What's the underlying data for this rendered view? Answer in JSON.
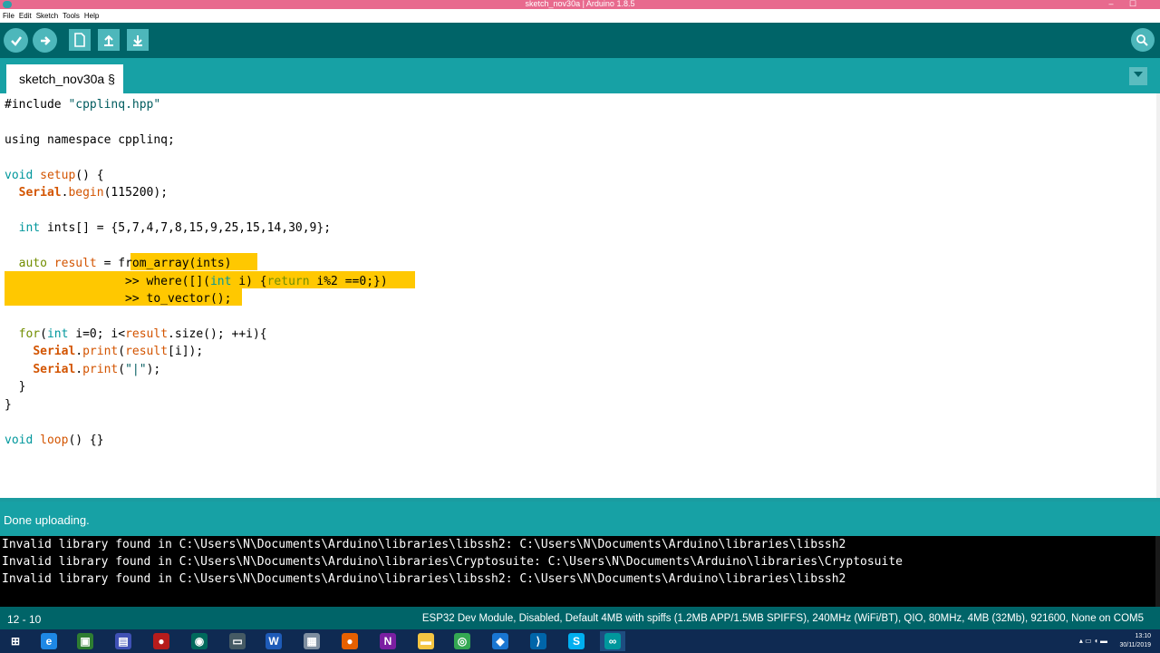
{
  "window": {
    "title": "sketch_nov30a | Arduino 1.8.5",
    "controls": [
      "–",
      "☐"
    ]
  },
  "menu": [
    "File",
    "Edit",
    "Sketch",
    "Tools",
    "Help"
  ],
  "toolbar": {
    "verify_icon": "check-icon",
    "upload_icon": "arrow-right-icon",
    "new_icon": "new-file-icon",
    "open_icon": "arrow-up-icon",
    "save_icon": "arrow-down-icon",
    "serial_monitor_icon": "magnifier-icon"
  },
  "tab": {
    "label": "sketch_nov30a §"
  },
  "editor": {
    "lines": [
      {
        "segments": [
          {
            "t": "#include ",
            "c": ""
          },
          {
            "t": "\"cpplinq.hpp\"",
            "c": "str"
          }
        ]
      },
      {
        "segments": []
      },
      {
        "segments": [
          {
            "t": "using namespace cpplinq;",
            "c": ""
          }
        ]
      },
      {
        "segments": []
      },
      {
        "segments": [
          {
            "t": "void",
            "c": "kw"
          },
          {
            "t": " ",
            "c": ""
          },
          {
            "t": "setup",
            "c": "fn"
          },
          {
            "t": "() {",
            "c": ""
          }
        ]
      },
      {
        "segments": [
          {
            "t": "  ",
            "c": ""
          },
          {
            "t": "Serial",
            "c": "cls"
          },
          {
            "t": ".",
            "c": ""
          },
          {
            "t": "begin",
            "c": "fn"
          },
          {
            "t": "(115200);",
            "c": ""
          }
        ]
      },
      {
        "segments": []
      },
      {
        "segments": [
          {
            "t": "  ",
            "c": ""
          },
          {
            "t": "int",
            "c": "kw"
          },
          {
            "t": " ints[] = {5,7,4,7,8,15,9,25,15,14,30,9};",
            "c": ""
          }
        ]
      },
      {
        "segments": []
      },
      {
        "segments": [
          {
            "t": "  ",
            "c": ""
          },
          {
            "t": "auto",
            "c": "kw2"
          },
          {
            "t": " ",
            "c": ""
          },
          {
            "t": "result",
            "c": "fn"
          },
          {
            "t": " = ",
            "c": ""
          },
          {
            "t": "from_array(ints)",
            "c": ""
          }
        ]
      },
      {
        "segments": [
          {
            "t": "                 >> where([](",
            "c": ""
          },
          {
            "t": "int",
            "c": "kw"
          },
          {
            "t": " i) {",
            "c": ""
          },
          {
            "t": "return",
            "c": "kw2"
          },
          {
            "t": " i%2 ==0;})",
            "c": ""
          }
        ]
      },
      {
        "segments": [
          {
            "t": "                 >> to_vector();",
            "c": ""
          }
        ]
      },
      {
        "segments": []
      },
      {
        "segments": [
          {
            "t": "  ",
            "c": ""
          },
          {
            "t": "for",
            "c": "kw2"
          },
          {
            "t": "(",
            "c": ""
          },
          {
            "t": "int",
            "c": "kw"
          },
          {
            "t": " i=0; i<",
            "c": ""
          },
          {
            "t": "result",
            "c": "fn"
          },
          {
            "t": ".size(); ++i){",
            "c": ""
          }
        ]
      },
      {
        "segments": [
          {
            "t": "    ",
            "c": ""
          },
          {
            "t": "Serial",
            "c": "cls"
          },
          {
            "t": ".",
            "c": ""
          },
          {
            "t": "print",
            "c": "fn"
          },
          {
            "t": "(",
            "c": ""
          },
          {
            "t": "result",
            "c": "fn"
          },
          {
            "t": "[i]);",
            "c": ""
          }
        ]
      },
      {
        "segments": [
          {
            "t": "    ",
            "c": ""
          },
          {
            "t": "Serial",
            "c": "cls"
          },
          {
            "t": ".",
            "c": ""
          },
          {
            "t": "print",
            "c": "fn"
          },
          {
            "t": "(",
            "c": ""
          },
          {
            "t": "\"|\"",
            "c": "str"
          },
          {
            "t": ");",
            "c": ""
          }
        ]
      },
      {
        "segments": [
          {
            "t": "  }",
            "c": ""
          }
        ]
      },
      {
        "segments": [
          {
            "t": "}",
            "c": ""
          }
        ]
      },
      {
        "segments": []
      },
      {
        "segments": [
          {
            "t": "void",
            "c": "kw"
          },
          {
            "t": " ",
            "c": ""
          },
          {
            "t": "loop",
            "c": "fn"
          },
          {
            "t": "() {}",
            "c": ""
          }
        ]
      }
    ],
    "selection_color": "#ffc800"
  },
  "status": {
    "message": "Done uploading."
  },
  "console": {
    "lines": [
      "Invalid library found in C:\\Users\\N\\Documents\\Arduino\\libraries\\libssh2: C:\\Users\\N\\Documents\\Arduino\\libraries\\libssh2",
      "Invalid library found in C:\\Users\\N\\Documents\\Arduino\\libraries\\Cryptosuite: C:\\Users\\N\\Documents\\Arduino\\libraries\\Cryptosuite",
      "Invalid library found in C:\\Users\\N\\Documents\\Arduino\\libraries\\libssh2: C:\\Users\\N\\Documents\\Arduino\\libraries\\libssh2"
    ]
  },
  "footer": {
    "cursor": "12 - 10",
    "board": "ESP32 Dev Module, Disabled, Default 4MB with spiffs (1.2MB APP/1.5MB SPIFFS), 240MHz (WiFi/BT), QIO, 80MHz, 4MB (32Mb), 921600, None on COM5"
  },
  "taskbar": {
    "apps": [
      {
        "name": "windows-start-icon",
        "glyph": "⊞",
        "color": "#0f2a52"
      },
      {
        "name": "ie-icon",
        "glyph": "e",
        "color": "#1e88e5"
      },
      {
        "name": "app-green-icon",
        "glyph": "▣",
        "color": "#2e7d32"
      },
      {
        "name": "monitor-app-icon",
        "glyph": "▤",
        "color": "#3f51b5"
      },
      {
        "name": "pdf-reader-icon",
        "glyph": "●",
        "color": "#b71c1c"
      },
      {
        "name": "settings-app-icon",
        "glyph": "◉",
        "color": "#00695c"
      },
      {
        "name": "remote-desktop-icon",
        "glyph": "▭",
        "color": "#455a64"
      },
      {
        "name": "word-icon",
        "glyph": "W",
        "color": "#1e5bb8"
      },
      {
        "name": "file-manager-icon",
        "glyph": "▦",
        "color": "#7e8ea0"
      },
      {
        "name": "firefox-icon",
        "glyph": "●",
        "color": "#e66000"
      },
      {
        "name": "onenote-icon",
        "glyph": "N",
        "color": "#7b1fa2"
      },
      {
        "name": "explorer-icon",
        "glyph": "▬",
        "color": "#f4c542"
      },
      {
        "name": "chrome-icon",
        "glyph": "◎",
        "color": "#34a853"
      },
      {
        "name": "app-blue-icon",
        "glyph": "◆",
        "color": "#1976d2"
      },
      {
        "name": "vscode-icon",
        "glyph": "⟩",
        "color": "#0065a9"
      },
      {
        "name": "skype-icon",
        "glyph": "S",
        "color": "#00aff0"
      },
      {
        "name": "arduino-icon",
        "glyph": "∞",
        "color": "#00979c"
      }
    ],
    "time": "13:10",
    "date": "30/11/2019"
  }
}
